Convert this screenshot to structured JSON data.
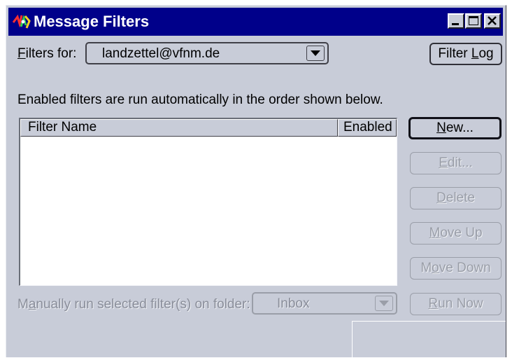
{
  "window": {
    "title": "Message Filters"
  },
  "filters_for": {
    "label_prefix": "",
    "label_mnemonic": "F",
    "label_rest": "ilters for:",
    "account_value": "landzettel@vfnm.de"
  },
  "filter_log_button": {
    "pre": "Filter ",
    "mnemonic": "L",
    "post": "og"
  },
  "description": "Enabled filters are run automatically in the order shown below.",
  "filter_list": {
    "columns": [
      "Filter Name",
      "Enabled"
    ],
    "rows": []
  },
  "buttons": {
    "new": {
      "pre": "",
      "mnemonic": "N",
      "post": "ew...",
      "enabled": true
    },
    "edit": {
      "pre": "",
      "mnemonic": "E",
      "post": "dit...",
      "enabled": false
    },
    "delete": {
      "pre": "",
      "mnemonic": "D",
      "post": "elete",
      "enabled": false
    },
    "move_up": {
      "pre": "",
      "mnemonic": "M",
      "post": "ove Up",
      "enabled": false
    },
    "move_down": {
      "pre": "M",
      "mnemonic": "o",
      "post": "ve Down",
      "enabled": false
    },
    "run_now": {
      "pre": "",
      "mnemonic": "R",
      "post": "un Now",
      "enabled": false
    }
  },
  "manual_run": {
    "label_pre": "M",
    "label_mnemonic": "a",
    "label_post": "nually run selected filter(s) on folder:",
    "folder_value": "Inbox"
  },
  "icons": {
    "app": "filter-app-icon",
    "minimize": "minimize-icon",
    "maximize": "maximize-icon",
    "close": "close-icon",
    "dropdown": "chevron-down-icon"
  },
  "colors": {
    "titlebar": "#00008a",
    "window_bg": "#c8ccd8",
    "disabled_text": "#8a8e9a"
  }
}
